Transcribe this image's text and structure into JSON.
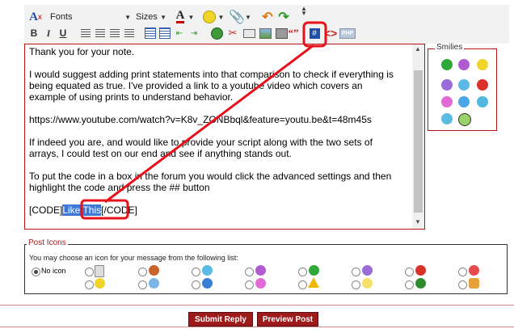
{
  "toolbar": {
    "fonts_label": "Fonts",
    "sizes_label": "Sizes",
    "bold": "B",
    "italic": "I",
    "underline": "U",
    "quote": "“”",
    "php": "PHP"
  },
  "editor": {
    "paragraphs": [
      "Thank you for your note.",
      "I would suggest adding print statements into that comparison to check if everything is",
      "being equated as true.  I've provided a link to a youtube video which covers an",
      "example of using prints to understand behavior.",
      "https://www.youtube.com/watch?v=K8v_ZONBbql&feature=youtu.be&t=48m45s",
      "If indeed you are, and would like to provide your script along with the two sets of",
      "arrays, I could test on our end and see if anything stands out.",
      "To put the code in a box in the forum you would click the advanced settings and then",
      "highlight the code and press the ## button"
    ],
    "code_open": "[CODE]",
    "code_selected": "Like This",
    "code_close": "[/CODE]"
  },
  "smilies": {
    "title": "Smilies",
    "items": [
      "grin",
      "wink-purple",
      "smile",
      "confused",
      "eek",
      "mad",
      "tongue",
      "cool-blue",
      "frown",
      "sunglasses",
      "eek-glasses"
    ]
  },
  "post_icons": {
    "title": "Post Icons",
    "hint": "You may choose an icon for your message from the following list:",
    "no_icon": "No icon",
    "icons": [
      "document",
      "thumbs-down",
      "smile",
      "mad-purple",
      "grin",
      "angry-purple",
      "red-mad",
      "smile-yellow",
      "cool",
      "question",
      "devil",
      "alert",
      "lightbulb",
      "arrow-right",
      "thumbs-up"
    ]
  },
  "buttons": {
    "submit": "Submit Reply",
    "preview": "Preview Post"
  },
  "colors": {
    "accent": "#9e1b1b",
    "annotation": "#e8101a",
    "selection": "#3d78d8"
  }
}
